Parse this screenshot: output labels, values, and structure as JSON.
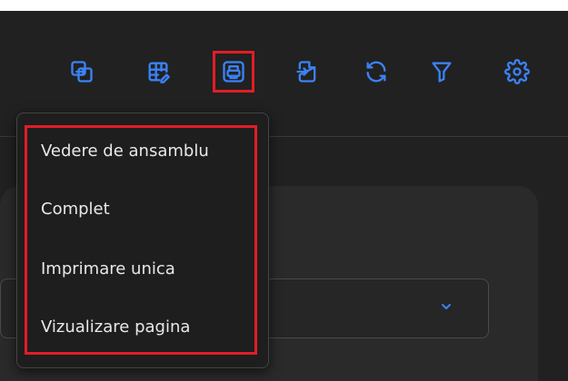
{
  "toolbar": {
    "icon_color": "#3b82f6",
    "highlight_color": "#e11d27",
    "buttons": [
      {
        "name": "copy-swap-icon"
      },
      {
        "name": "table-edit-icon"
      },
      {
        "name": "print-icon"
      },
      {
        "name": "export-file-icon"
      },
      {
        "name": "refresh-icon"
      },
      {
        "name": "filter-icon"
      },
      {
        "name": "settings-icon"
      }
    ]
  },
  "print_menu": {
    "items": [
      {
        "label": "Vedere de ansamblu"
      },
      {
        "label": "Complet"
      },
      {
        "label": "Imprimare unica"
      },
      {
        "label": "Vizualizare pagina"
      }
    ]
  }
}
